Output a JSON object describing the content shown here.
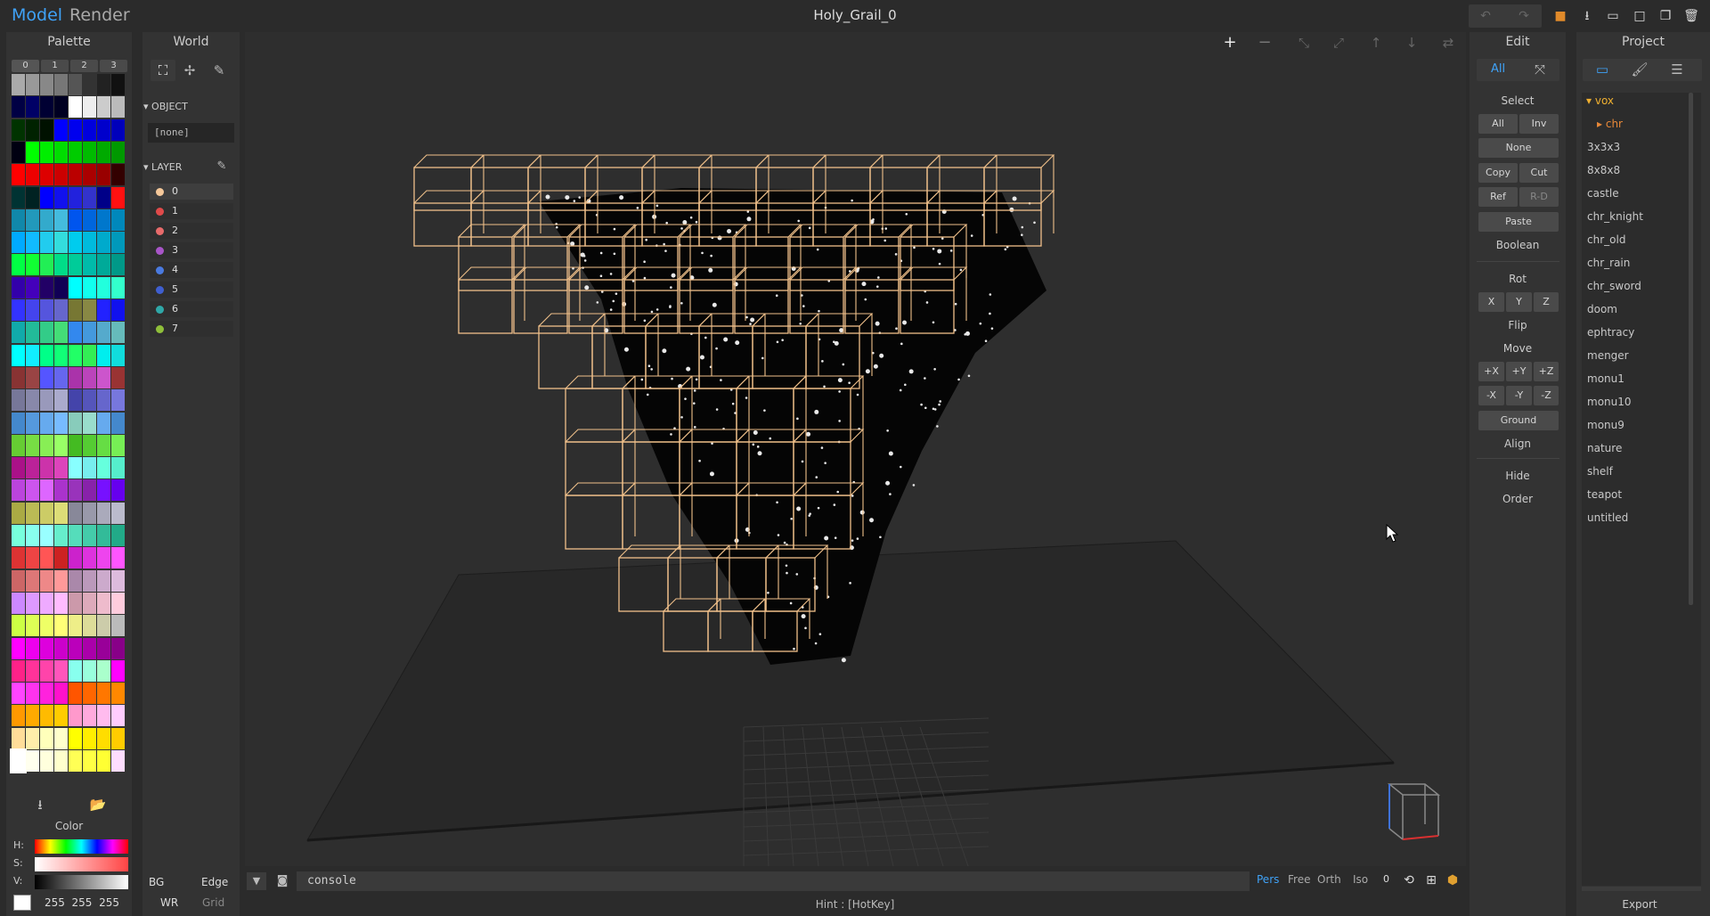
{
  "app": {
    "mode_tabs": [
      "Model",
      "Render"
    ],
    "active_mode": "Model",
    "title": "Holy_Grail_0",
    "toolbar_icons": [
      "undo-icon",
      "redo-icon",
      "save-icon",
      "import-icon",
      "open-icon",
      "new-icon",
      "duplicate-icon",
      "delete-icon"
    ]
  },
  "palette": {
    "title": "Palette",
    "tabs": [
      "0",
      "1",
      "2",
      "3"
    ],
    "active_tab": "0",
    "import_icon": "import-icon",
    "open_icon": "folder-icon",
    "color_title": "Color",
    "hsv_labels": [
      "H:",
      "S:",
      "V:"
    ],
    "rgb_text": "255  255  255",
    "bg_label": "BG",
    "edge_label": "Edge",
    "wr_label": "WR",
    "grid_label": "Grid"
  },
  "world": {
    "title": "World",
    "tools": [
      "select-icon",
      "move-icon",
      "pencil-icon"
    ],
    "object_label": "OBJECT",
    "object_value": "[none]",
    "layer_label": "LAYER",
    "layers": [
      {
        "name": "0",
        "color": "#f5c89a"
      },
      {
        "name": "1",
        "color": "#e04a4a"
      },
      {
        "name": "2",
        "color": "#e86b6b"
      },
      {
        "name": "3",
        "color": "#a855c8"
      },
      {
        "name": "4",
        "color": "#4a7ae0"
      },
      {
        "name": "5",
        "color": "#3f5fd0"
      },
      {
        "name": "6",
        "color": "#2fa8a8"
      },
      {
        "name": "7",
        "color": "#8fbf3a"
      }
    ]
  },
  "viewport": {
    "top_icons": [
      "add-icon",
      "remove-icon",
      "shrink-icon",
      "expand-icon",
      "up-icon",
      "down-icon",
      "swap-icon"
    ],
    "console_placeholder": "console",
    "view_modes": [
      "Pers",
      "Free",
      "Orth",
      "Iso"
    ],
    "active_view": "Pers",
    "zoom_value": "0",
    "hint": "Hint : [HotKey]",
    "model_color": "#f0c08a"
  },
  "edit": {
    "title": "Edit",
    "top_buttons": [
      "All"
    ],
    "select_label": "Select",
    "select_buttons": [
      "All",
      "Inv",
      "None",
      "Copy",
      "Cut",
      "Ref",
      "R-D",
      "Paste"
    ],
    "boolean_label": "Boolean",
    "rot_label": "Rot",
    "rot_buttons": [
      "X",
      "Y",
      "Z"
    ],
    "flip_label": "Flip",
    "move_label": "Move",
    "move_buttons": [
      "+X",
      "+Y",
      "+Z",
      "-X",
      "-Y",
      "-Z"
    ],
    "ground_label": "Ground",
    "align_label": "Align",
    "hide_label": "Hide",
    "order_label": "Order"
  },
  "project": {
    "title": "Project",
    "tree_root": "vox",
    "tree_sub": "chr",
    "files": [
      "3x3x3",
      "8x8x8",
      "castle",
      "chr_knight",
      "chr_old",
      "chr_rain",
      "chr_sword",
      "doom",
      "ephtracy",
      "menger",
      "monu1",
      "monu10",
      "monu9",
      "nature",
      "shelf",
      "teapot",
      "untitled"
    ],
    "export_label": "Export"
  }
}
